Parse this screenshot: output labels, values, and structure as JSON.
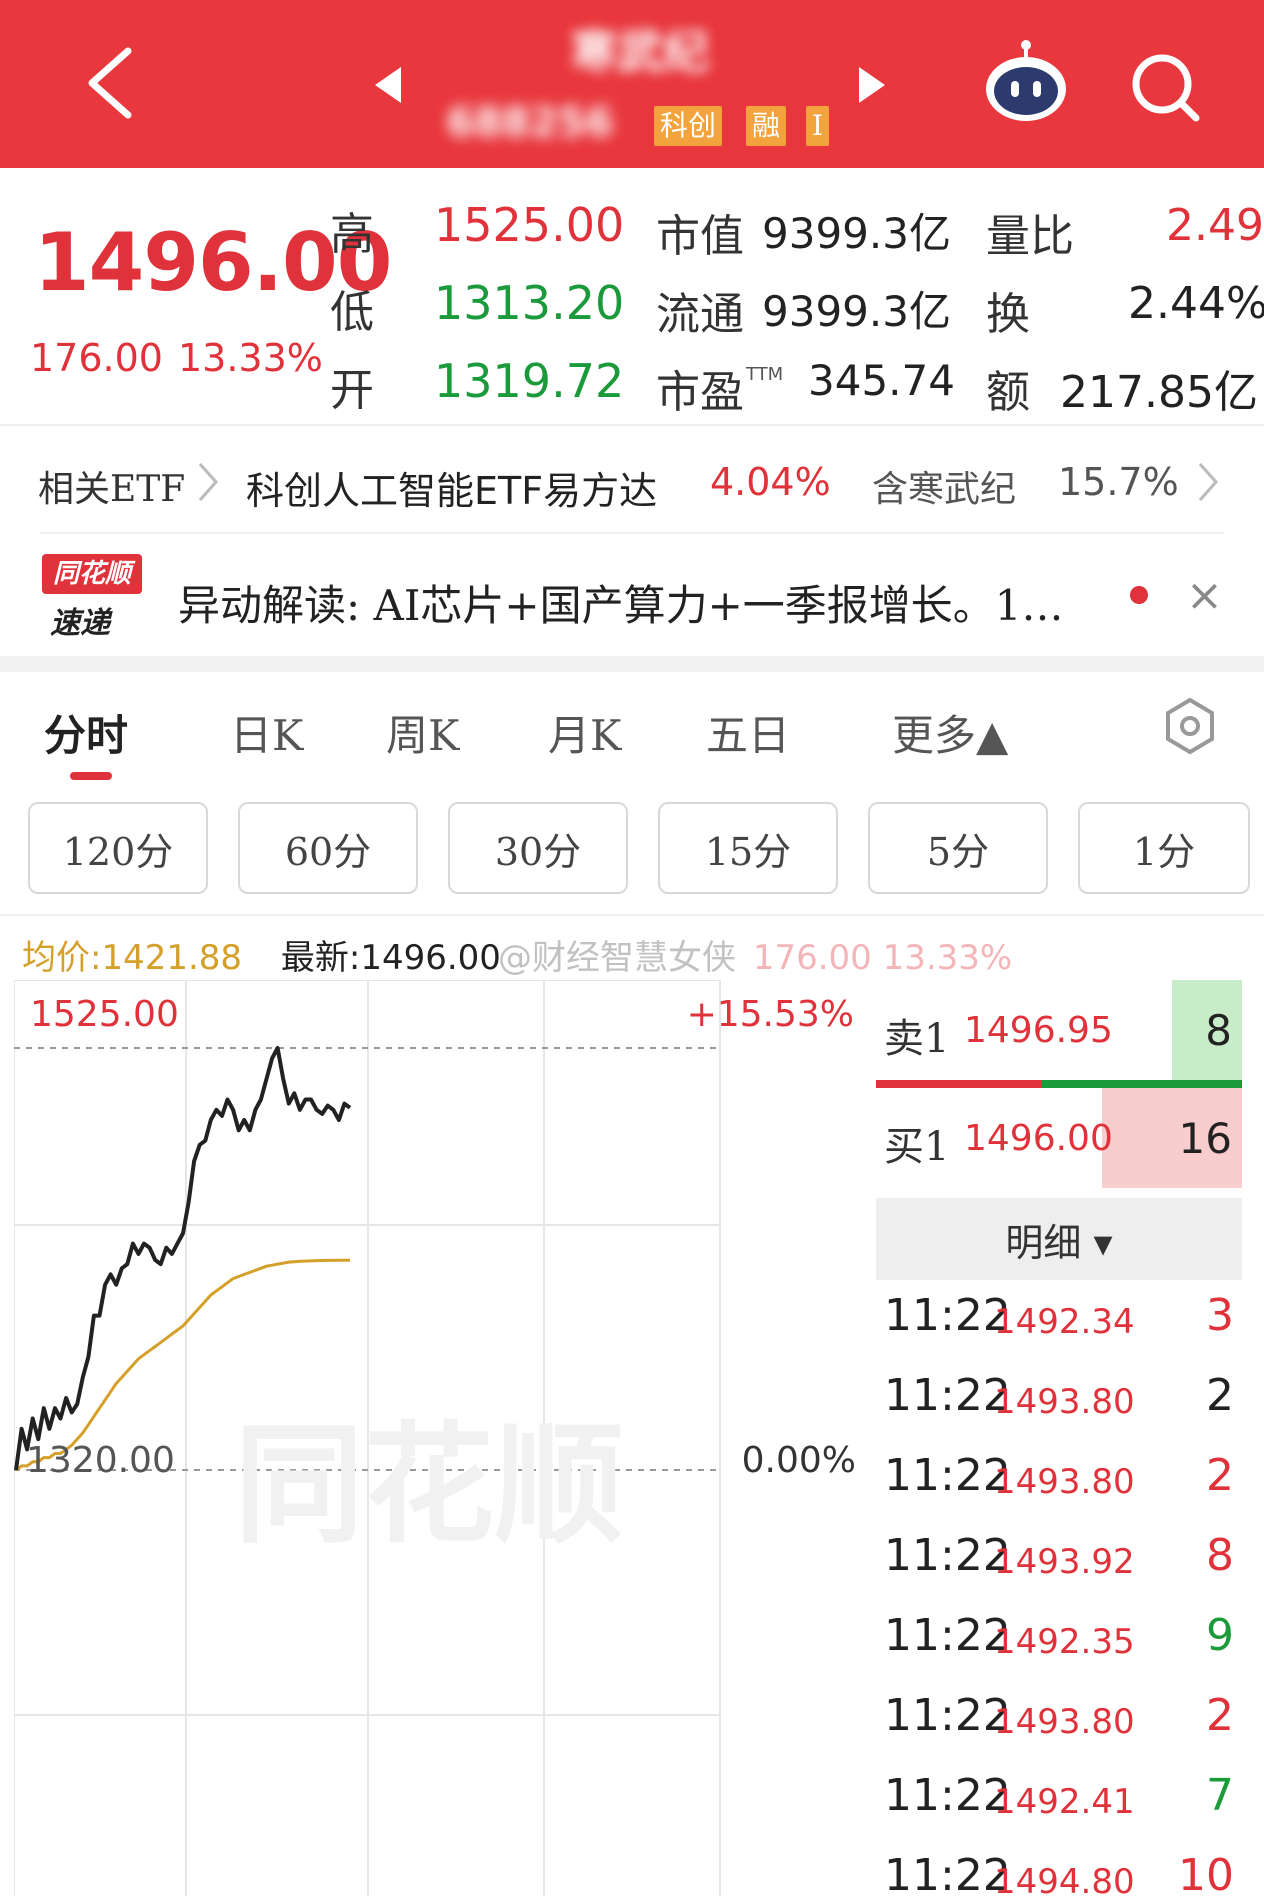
{
  "header": {
    "stock_name": "寒武纪",
    "stock_code": "688256",
    "tags": [
      "科创",
      "融",
      "I"
    ],
    "colors": {
      "bg": "#e8373d",
      "tag": "#f3a33d"
    },
    "icons": [
      "back-arrow-icon",
      "prev-arrow-icon",
      "next-arrow-icon",
      "robot-assistant-icon",
      "search-icon"
    ]
  },
  "quote": {
    "price": "1496.00",
    "change": "176.00",
    "change_pct": "13.33%",
    "high_label": "高",
    "high": "1525.00",
    "low_label": "低",
    "low": "1313.20",
    "open_label": "开",
    "open": "1319.72",
    "mktcap_label": "市值",
    "mktcap": "9399.3亿",
    "float_label": "流通",
    "float": "9399.3亿",
    "pe_label": "市盈",
    "pe_sup": "TTM",
    "pe": "345.74",
    "vol_ratio_label": "量比",
    "vol_ratio": "2.49",
    "turnover_label": "换",
    "turnover": "2.44%",
    "amount_label": "额",
    "amount": "217.85亿"
  },
  "etf": {
    "label": "相关ETF",
    "name": "科创人工智能ETF易方达",
    "pct": "4.04%",
    "holding": "含寒武纪",
    "holding_pct": "15.7%"
  },
  "news": {
    "logo_line1": "同花顺",
    "logo_line2": "速递",
    "text": "异动解读: AI芯片+国产算力+一季报增长。1…",
    "close": "×"
  },
  "tabs": [
    {
      "label": "分时",
      "active": true
    },
    {
      "label": "日K"
    },
    {
      "label": "周K"
    },
    {
      "label": "月K"
    },
    {
      "label": "五日"
    },
    {
      "label": "更多▲"
    }
  ],
  "periods": [
    "120分",
    "60分",
    "30分",
    "15分",
    "5分",
    "1分"
  ],
  "info_line": {
    "avg_label": "均价:1421.88",
    "latest_label": "最新:1496.00",
    "change_overlay": "176.00  13.33%",
    "watermark": "@财经智慧女侠"
  },
  "chart_data": {
    "type": "line",
    "title": "",
    "y_top_label": "1525.00",
    "y_base_label": "1320.00",
    "right_top_label": "+15.53%",
    "right_base_label": "0.00%",
    "watermark": "同花顺",
    "ylim": [
      1085,
      1525
    ],
    "series": [
      {
        "name": "价格",
        "color": "#222222",
        "values": [
          1320,
          1340,
          1330,
          1345,
          1335,
          1350,
          1340,
          1350,
          1345,
          1355,
          1348,
          1352,
          1365,
          1375,
          1395,
          1395,
          1410,
          1415,
          1410,
          1418,
          1420,
          1430,
          1425,
          1430,
          1428,
          1422,
          1420,
          1428,
          1425,
          1430,
          1435,
          1450,
          1470,
          1478,
          1480,
          1490,
          1495,
          1492,
          1500,
          1495,
          1485,
          1490,
          1485,
          1495,
          1500,
          1510,
          1520,
          1525,
          1510,
          1498,
          1503,
          1495,
          1500,
          1500,
          1495,
          1493,
          1497,
          1495,
          1490,
          1498,
          1496
        ]
      },
      {
        "name": "均价",
        "color": "#d4a02a",
        "values": [
          1320,
          1322,
          1322,
          1324,
          1324,
          1326,
          1326,
          1328,
          1328,
          1330,
          1332,
          1335,
          1338,
          1342,
          1346,
          1350,
          1354,
          1358,
          1362,
          1365,
          1368,
          1371,
          1374,
          1376,
          1378,
          1380,
          1382,
          1384,
          1386,
          1388,
          1390,
          1393,
          1396,
          1399,
          1402,
          1405,
          1407,
          1409,
          1411,
          1413,
          1414,
          1415,
          1416,
          1417,
          1418,
          1419,
          1419.5,
          1420,
          1420.5,
          1421,
          1421.2,
          1421.4,
          1421.5,
          1421.6,
          1421.7,
          1421.75,
          1421.8,
          1421.82,
          1421.85,
          1421.87,
          1421.88
        ]
      }
    ]
  },
  "orderbook": {
    "sell": {
      "label": "卖1",
      "price": "1496.95",
      "vol": "8"
    },
    "buy": {
      "label": "买1",
      "price": "1496.00",
      "vol": "16"
    },
    "detail_label": "明细 ▾",
    "ticks": [
      {
        "time": "11:22",
        "price": "1492.34",
        "vol": "3",
        "side": "red"
      },
      {
        "time": "11:22",
        "price": "1493.80",
        "vol": "2",
        "side": "dark"
      },
      {
        "time": "11:22",
        "price": "1493.80",
        "vol": "2",
        "side": "red"
      },
      {
        "time": "11:22",
        "price": "1493.92",
        "vol": "8",
        "side": "red"
      },
      {
        "time": "11:22",
        "price": "1492.35",
        "vol": "9",
        "side": "green"
      },
      {
        "time": "11:22",
        "price": "1493.80",
        "vol": "2",
        "side": "red"
      },
      {
        "time": "11:22",
        "price": "1492.41",
        "vol": "7",
        "side": "green"
      },
      {
        "time": "11:22",
        "price": "1494.80",
        "vol": "10",
        "side": "red"
      }
    ]
  }
}
